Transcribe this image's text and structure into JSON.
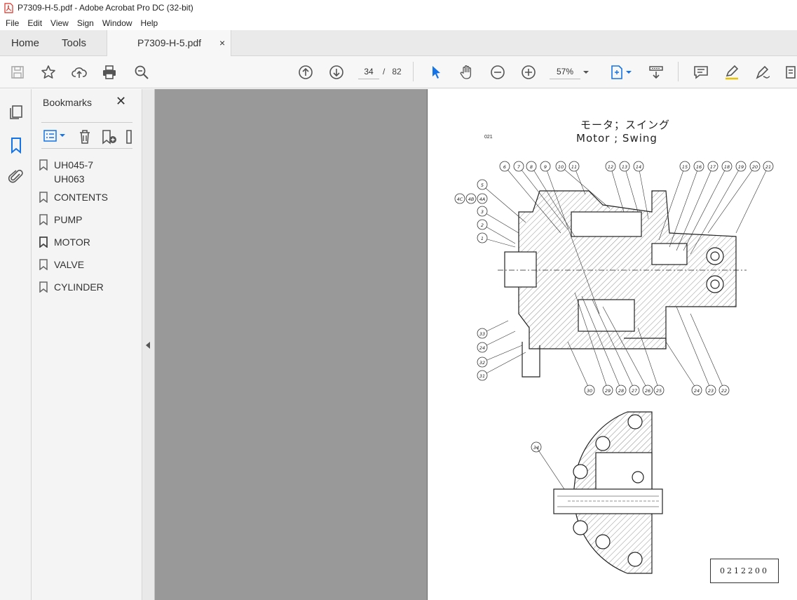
{
  "window": {
    "title": "P7309-H-5.pdf - Adobe Acrobat Pro DC (32-bit)"
  },
  "menu": [
    "File",
    "Edit",
    "View",
    "Sign",
    "Window",
    "Help"
  ],
  "tabs": {
    "home": "Home",
    "tools": "Tools",
    "document": "P7309-H-5.pdf",
    "close": "×"
  },
  "toolbar": {
    "current_page": "34",
    "page_separator": "/",
    "total_pages": "82",
    "zoom": "57%"
  },
  "bookmarks": {
    "title": "Bookmarks",
    "close": "✕",
    "items": [
      {
        "label": "UH045-7\nUH063"
      },
      {
        "label": "CONTENTS"
      },
      {
        "label": "PUMP"
      },
      {
        "label": "MOTOR"
      },
      {
        "label": "VALVE"
      },
      {
        "label": "CYLINDER"
      }
    ]
  },
  "document_page": {
    "title_jp": "モータ；スイング",
    "title_en": "Motor ; Swing",
    "page_code": "021",
    "figure_code": "0212200",
    "callouts_top": [
      "6",
      "7",
      "8",
      "9",
      "10",
      "11",
      "12",
      "13",
      "14",
      "15",
      "16",
      "17",
      "18",
      "19",
      "20",
      "21"
    ],
    "callouts_left": [
      "5",
      "4C",
      "4B",
      "4A",
      "3",
      "2",
      "1",
      "33",
      "24",
      "32",
      "31"
    ],
    "callouts_bottom": [
      "30",
      "29",
      "28",
      "27",
      "26",
      "25",
      "24",
      "23",
      "22"
    ],
    "callout_lower": "34"
  },
  "colors": {
    "accent_blue": "#1473e6",
    "canvas_gray": "#999999",
    "panel_bg": "#f4f4f4"
  }
}
